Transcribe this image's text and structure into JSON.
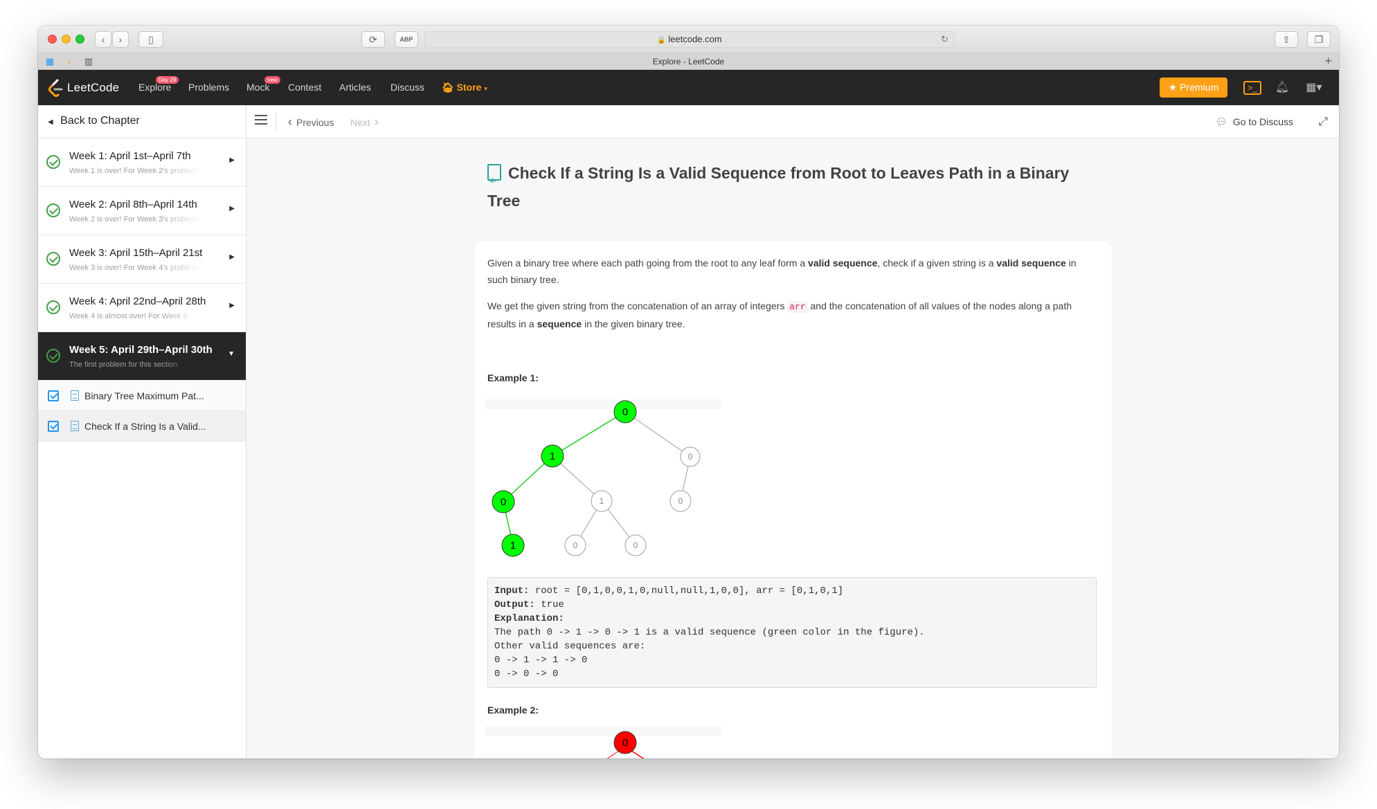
{
  "browser": {
    "url": "leetcode.com",
    "tab_title": "Explore - LeetCode"
  },
  "nav": {
    "logo_text": "LeetCode",
    "items": [
      {
        "label": "Explore",
        "badge": "Day 29"
      },
      {
        "label": "Problems"
      },
      {
        "label": "Mock",
        "badge": "new"
      },
      {
        "label": "Contest"
      },
      {
        "label": "Articles"
      },
      {
        "label": "Discuss"
      },
      {
        "label": "Store"
      }
    ],
    "premium_label": "Premium",
    "accent_color": "#ffa116"
  },
  "sidebar": {
    "back_label": "Back to Chapter",
    "weeks": [
      {
        "title": "Week 1: April 1st–April 7th",
        "subtitle": "Week 1 is over! For Week 2's problems",
        "active": false
      },
      {
        "title": "Week 2: April 8th–April 14th",
        "subtitle": "Week 2 is over! For Week 3's problems",
        "active": false
      },
      {
        "title": "Week 3: April 15th–April 21st",
        "subtitle": "Week 3 is over! For Week 4's problems",
        "active": false
      },
      {
        "title": "Week 4: April 22nd–April 28th",
        "subtitle": "Week 4 is almost over! For Week 5",
        "active": false
      },
      {
        "title": "Week 5: April 29th–April 30th",
        "subtitle": "The first problem for this section",
        "active": true
      }
    ],
    "sub_items": [
      {
        "title": "Binary Tree Maximum Pat...",
        "checked": true
      },
      {
        "title": "Check If a String Is a Valid...",
        "checked": true,
        "selected": true
      }
    ]
  },
  "toolbar": {
    "previous_label": "Previous",
    "next_label": "Next",
    "discuss_label": "Go to Discuss"
  },
  "question": {
    "title": "Check If a String Is a Valid Sequence from Root to Leaves Path in a Binary Tree",
    "para1_a": "Given a binary tree where each path going from the root to any leaf form a ",
    "para1_b": "valid sequence",
    "para1_c": ", check if a given string is a ",
    "para1_d": "valid sequence",
    "para1_e": " in such binary tree.",
    "para2_a": "We get the given string from the concatenation of an array of integers ",
    "para2_code": "arr",
    "para2_b": " and the concatenation of all values of the nodes along a path results in a ",
    "para2_c": "sequence",
    "para2_d": " in the given binary tree.",
    "example1_label": "Example 1:",
    "example2_label": "Example 2:",
    "example1_tree": {
      "nodes": [
        "0",
        "1",
        "0",
        "0",
        "1",
        "0",
        "1",
        "0",
        "0"
      ],
      "highlight_color": "#00ff00"
    },
    "example2_tree": {
      "root": "0",
      "highlight_color": "#ff0000"
    },
    "example1_output": {
      "input_label": "Input:",
      "input_value": " root = [0,1,0,0,1,0,null,null,1,0,0], arr = [0,1,0,1]",
      "output_label": "Output:",
      "output_value": " true",
      "explanation_label": "Explanation:",
      "lines": [
        "The path 0 -> 1 -> 0 -> 1 is a valid sequence (green color in the figure).",
        "Other valid sequences are:",
        "0 -> 1 -> 1 -> 0",
        "0 -> 0 -> 0"
      ]
    }
  }
}
